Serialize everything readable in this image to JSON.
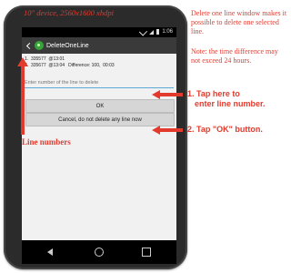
{
  "annotations": {
    "device_label": "10\" device, 2560x1600 xhdpi",
    "description": "Delete one line window makes it possible to delete one selected line.",
    "note": "Note: the time difference may not exceed 24 hours.",
    "step1_line1": "1.  Tap here to",
    "step1_line2": "enter line number.",
    "step2": "2.  Tap \"OK\" button.",
    "line_numbers_label": "Line numbers"
  },
  "status_bar": {
    "time": "1:06"
  },
  "action_bar": {
    "title": "DeleteOneLine"
  },
  "lines": [
    {
      "text": "1.  335577  @13:01"
    },
    {
      "text": "2.  335677  @13:04   Difference: 100,  00:03"
    }
  ],
  "input": {
    "placeholder": "Enter number of the line to delete",
    "value": ""
  },
  "buttons": {
    "ok": "OK",
    "cancel": "Cancel, do not delete any line now"
  },
  "colors": {
    "annotation": "#e23b2e",
    "app_icon": "#37a33a",
    "input_underline": "#5aa9d6"
  },
  "icons": {
    "back": "back-arrow-icon",
    "app": "app-icon",
    "wifi": "wifi-icon",
    "signal": "signal-icon",
    "battery": "battery-icon",
    "nav_back": "nav-back-icon",
    "nav_home": "nav-home-icon",
    "nav_recents": "nav-recents-icon"
  }
}
